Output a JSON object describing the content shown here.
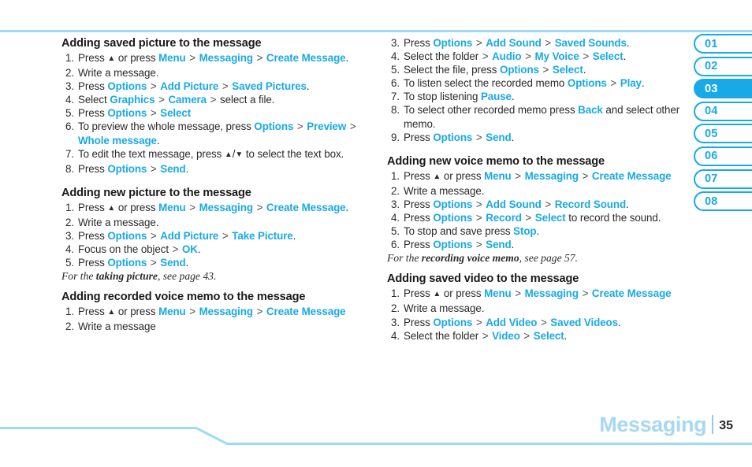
{
  "colors": {
    "link_blue": "#19a9e6",
    "rule_blue": "#9bdcf5",
    "footer_blue": "#a6d9f1"
  },
  "footer": {
    "chapter": "Messaging",
    "page_number": "35"
  },
  "tabs": [
    {
      "label": "01",
      "active": false
    },
    {
      "label": "02",
      "active": false
    },
    {
      "label": "03",
      "active": true
    },
    {
      "label": "04",
      "active": false
    },
    {
      "label": "05",
      "active": false
    },
    {
      "label": "06",
      "active": false
    },
    {
      "label": "07",
      "active": false
    },
    {
      "label": "08",
      "active": false
    }
  ],
  "left_column": {
    "sections": [
      {
        "title": "Adding saved picture to the message",
        "steps": [
          "1|Press {tri-up} or press {Menu} > {Messaging} > {Create Message}.",
          "2|Write a message.",
          "3|Press {Options} > {Add Picture} > {Saved Pictures}.",
          "4|Select {Graphics} > {Camera} > select a file.",
          "5|Press {Options} > {Select}",
          "6|To preview the whole message, press {Options} > {Preview} > {Whole message}.",
          "7|To edit the text message, press {tri-up}/{tri-down} to select the text box.",
          "8|Press {Options} > {Send}."
        ],
        "note": null
      },
      {
        "title": "Adding new picture to the message",
        "steps": [
          "1|Press {tri-up} or press {Menu} > {Messaging} > {Create Message.}",
          "2|Write a message.",
          "3|Press {Options} > {Add Picture} > {Take Picture}.",
          "4|Focus on the object > {OK}.",
          "5|Press {Options} > {Send}."
        ],
        "note": {
          "prefix": "For the ",
          "emphasis": "taking picture",
          "suffix": ", see page 43."
        }
      },
      {
        "title": "Adding recorded voice memo to the message",
        "steps": [
          "1|Press {tri-up} or press {Menu} > {Messaging} > {Create Message}",
          "2|Write a message"
        ],
        "note": null
      }
    ]
  },
  "right_column": {
    "sections": [
      {
        "title": null,
        "steps": [
          "3|Press {Options} > {Add Sound} > {Saved Sounds}.",
          "4|Select the folder > {Audio} > {My Voice} > {Select}.",
          "5|Select the file, press {Options} > {Select}.",
          "6|To listen select the recorded memo {Options} > {Play}.",
          "7|To stop listening {Pause}.",
          "8|To select other recorded memo press {Back} and select other memo.",
          "9|Press {Options} > {Send}."
        ],
        "note": null
      },
      {
        "title": "Adding new voice memo to the message",
        "steps": [
          "1|Press {tri-up} or press {Menu} > {Messaging} > {Create Message}",
          "2|Write a message.",
          "3|Press {Options} > {Add Sound} > {Record Sound}.",
          "4|Press {Options} > {Record} > {Select} to record the sound.",
          "5|To stop and save press {Stop}.",
          "6|Press {Options} > {Send}."
        ],
        "note": {
          "prefix": "For the ",
          "emphasis": "recording voice memo",
          "suffix": ", see page 57."
        }
      },
      {
        "title": "Adding saved video to the message",
        "steps": [
          "1|Press {tri-up} or press {Menu} > {Messaging} > {Create Message}",
          "2|Write a message.",
          "3|Press {Options} > {Add Video} > {Saved Videos}.",
          "4|Select the folder > {Video} > {Select}."
        ],
        "note": null
      }
    ]
  }
}
